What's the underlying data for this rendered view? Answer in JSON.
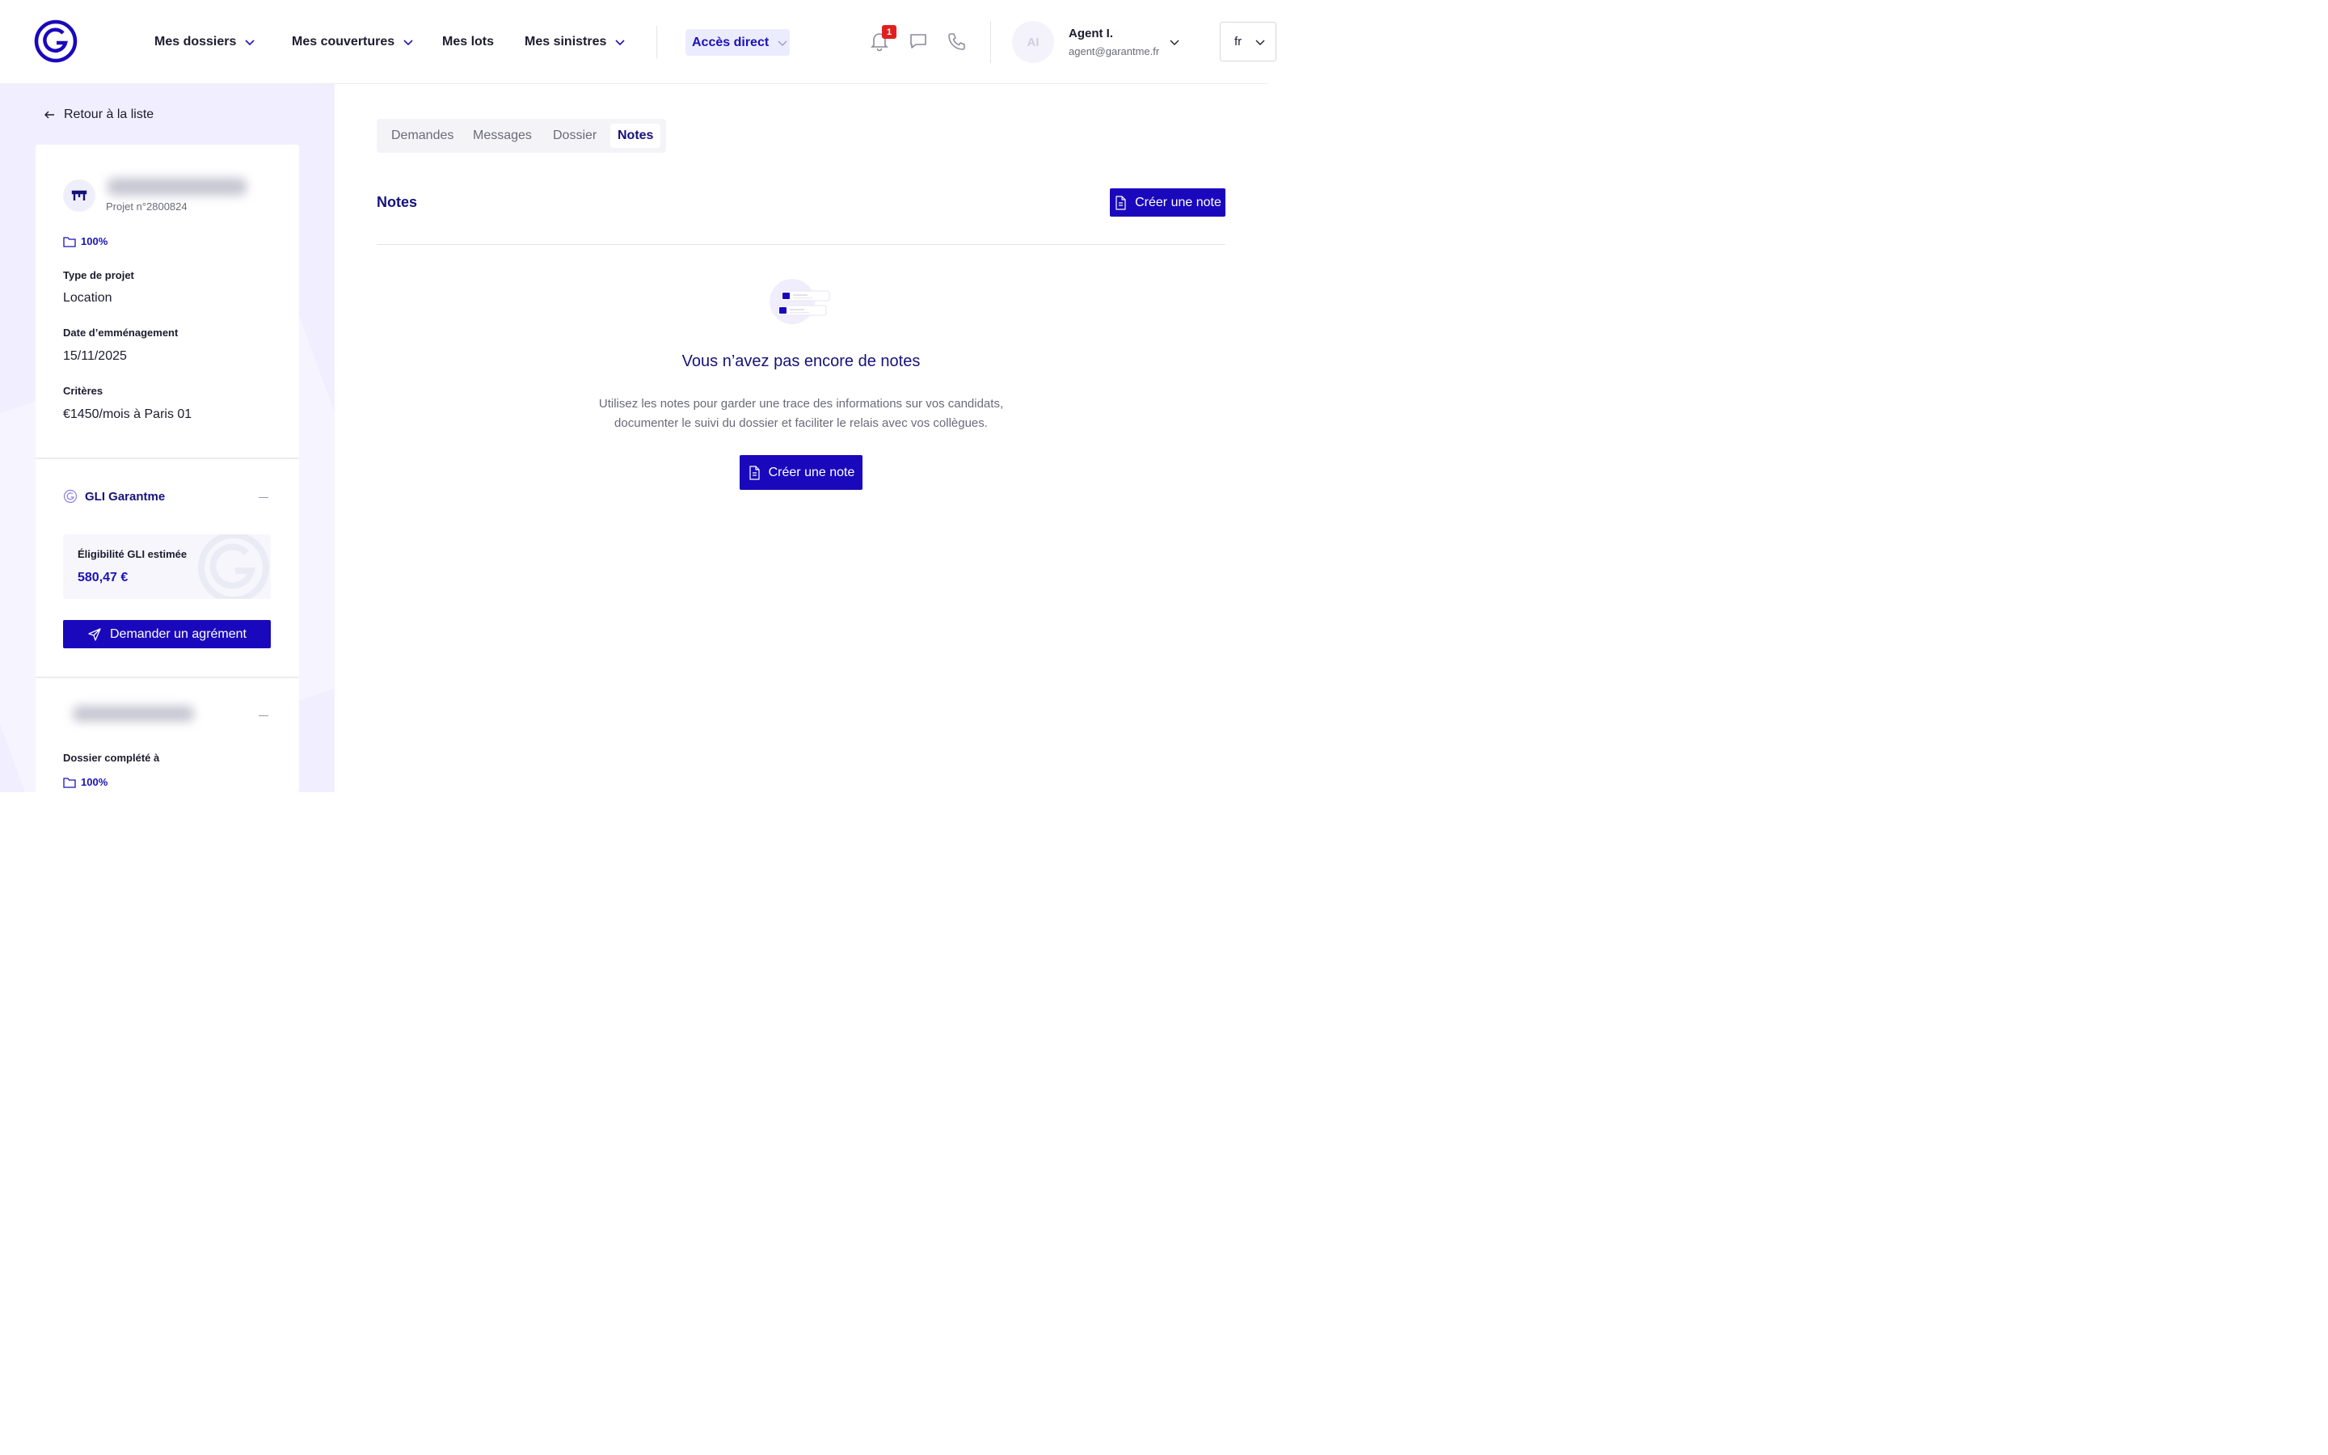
{
  "header": {
    "nav": [
      {
        "label": "Mes dossiers",
        "dropdown": true
      },
      {
        "label": "Mes couvertures",
        "dropdown": true
      },
      {
        "label": "Mes lots",
        "dropdown": false
      },
      {
        "label": "Mes sinistres",
        "dropdown": true
      }
    ],
    "direct_access": "Accès direct",
    "notifications_count": "1",
    "user": {
      "initials": "AI",
      "name": "Agent I.",
      "email": "agent@garantme.fr"
    },
    "language": "fr"
  },
  "sidebar": {
    "back_label": "Retour à la liste",
    "project": {
      "number": "Projet n°2800824",
      "completion": "100%",
      "type_label": "Type de projet",
      "type_value": "Location",
      "move_date_label": "Date d’emménagement",
      "move_date_value": "15/11/2025",
      "criteria_label": "Critères",
      "criteria_value": "€1450/mois à Paris 01"
    },
    "gli": {
      "title": "GLI Garantme",
      "eligibility_label": "Éligibilité GLI estimée",
      "eligibility_value": "580,47 €",
      "request_button": "Demander un agrément"
    },
    "dossier": {
      "completed_label": "Dossier complété à",
      "completion": "100%"
    }
  },
  "main": {
    "tabs": [
      {
        "label": "Demandes",
        "active": false
      },
      {
        "label": "Messages",
        "active": false
      },
      {
        "label": "Dossier",
        "active": false
      },
      {
        "label": "Notes",
        "active": true
      }
    ],
    "section_title": "Notes",
    "create_note_label": "Créer une note",
    "empty": {
      "title": "Vous n’avez pas encore de notes",
      "line1": "Utilisez les notes pour garder une trace des informations sur vos candidats,",
      "line2": "documenter le suivi du dossier et faciliter le relais avec vos collègues.",
      "button": "Créer une note"
    }
  },
  "colors": {
    "brand": "#1a08bd",
    "navy": "#16127a",
    "sidebar_bg": "#f1efff",
    "badge": "#e02020"
  },
  "icons": [
    "garantme-logo",
    "chevron-down-icon",
    "bell-icon",
    "chat-icon",
    "phone-icon",
    "arrow-left-icon",
    "building-icon",
    "folder-icon",
    "garantme-g-icon",
    "minus-icon",
    "send-icon",
    "document-icon",
    "empty-notes-illustration"
  ]
}
